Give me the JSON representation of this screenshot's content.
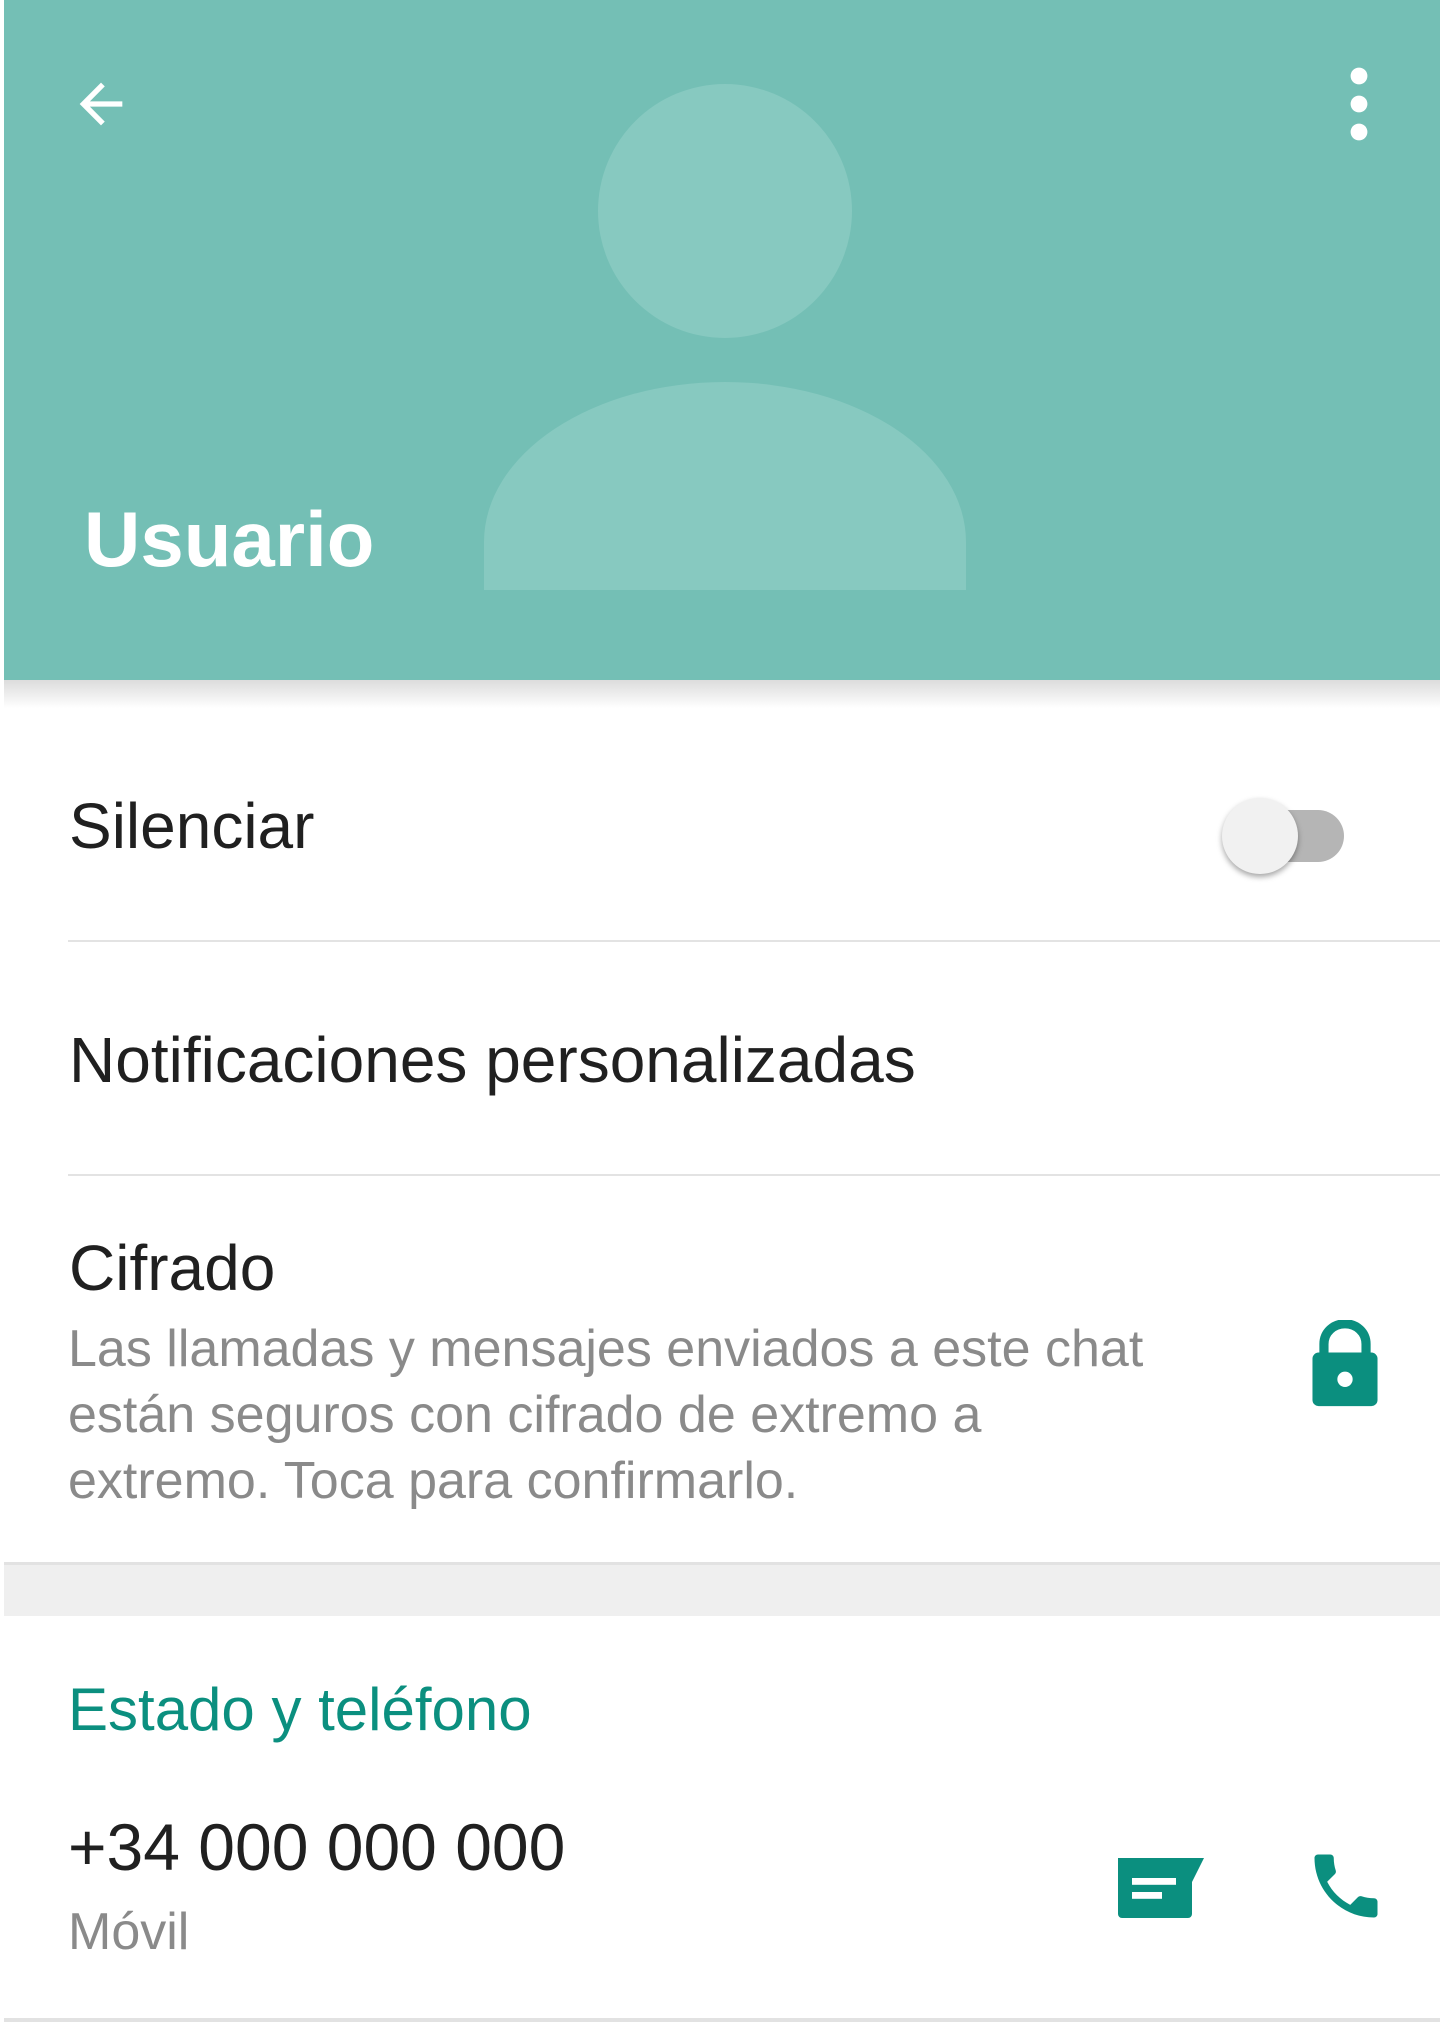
{
  "header": {
    "contact_name": "Usuario",
    "back_icon": "arrow-back-icon",
    "menu_icon": "more-vert-icon",
    "avatar_icon": "person-placeholder-icon"
  },
  "settings": {
    "mute": {
      "label": "Silenciar",
      "enabled": false
    },
    "custom_notifications": {
      "label": "Notificaciones personalizadas"
    },
    "encryption": {
      "label": "Cifrado",
      "description": "Las llamadas y mensajes enviados a este chat están seguros con cifrado de extremo a extremo. Toca para confirmarlo.",
      "icon": "lock-icon"
    }
  },
  "status_phone": {
    "section_title": "Estado y teléfono",
    "phone_number": "+34 000 000 000",
    "phone_type": "Móvil",
    "message_icon": "message-icon",
    "call_icon": "phone-icon"
  },
  "colors": {
    "header": "#74bfb5",
    "accent": "#0b8f7f"
  }
}
